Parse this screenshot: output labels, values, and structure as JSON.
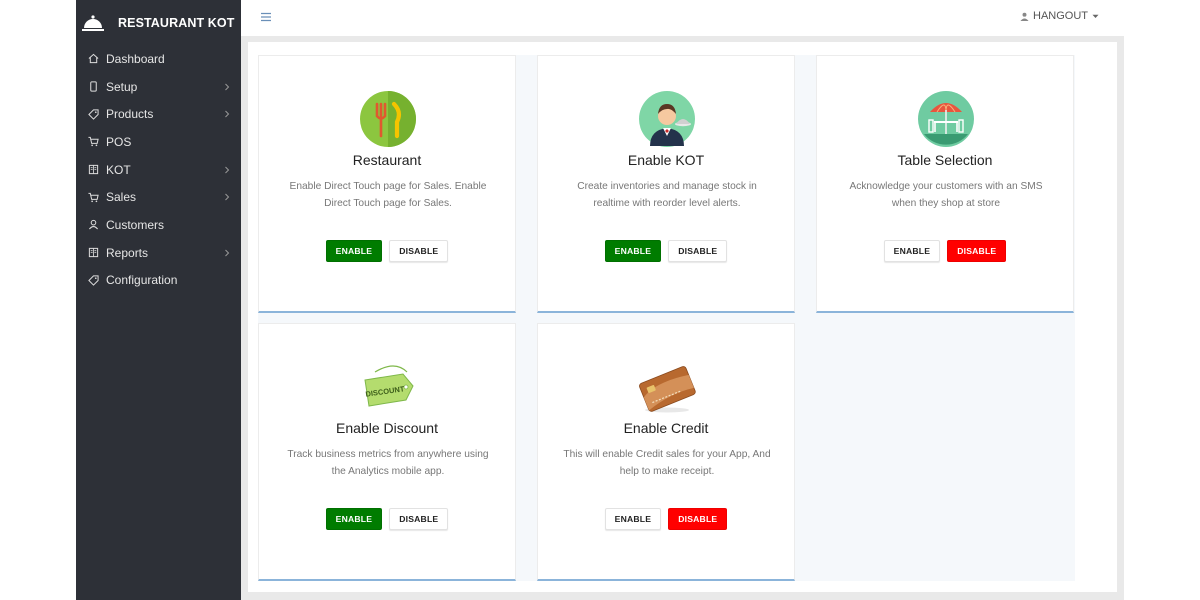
{
  "brand": {
    "title": "RESTAURANT KOT"
  },
  "sidebar": {
    "items": [
      {
        "label": "Dashboard",
        "icon": "home-icon",
        "submenu": false
      },
      {
        "label": "Setup",
        "icon": "phone-icon",
        "submenu": true
      },
      {
        "label": "Products",
        "icon": "tag-icon",
        "submenu": true
      },
      {
        "label": "POS",
        "icon": "cart-icon",
        "submenu": false
      },
      {
        "label": "KOT",
        "icon": "book-icon",
        "submenu": true
      },
      {
        "label": "Sales",
        "icon": "cart-icon",
        "submenu": true
      },
      {
        "label": "Customers",
        "icon": "user-icon",
        "submenu": false
      },
      {
        "label": "Reports",
        "icon": "book-icon",
        "submenu": true
      },
      {
        "label": "Configuration",
        "icon": "tag-icon",
        "submenu": false
      }
    ]
  },
  "header": {
    "user": "HANGOUT"
  },
  "cards": [
    {
      "title": "Restaurant",
      "desc": "Enable Direct Touch page for Sales. Enable Direct Touch page for Sales.",
      "enable": "ENABLE",
      "disable": "DISABLE",
      "state": "enabled",
      "illustration": "cutlery-icon"
    },
    {
      "title": "Enable KOT",
      "desc": "Create inventories and manage stock in realtime with reorder level alerts.",
      "enable": "ENABLE",
      "disable": "DISABLE",
      "state": "enabled",
      "illustration": "waiter-icon"
    },
    {
      "title": "Table Selection",
      "desc": "Acknowledge your customers with an SMS when they shop at store",
      "enable": "ENABLE",
      "disable": "DISABLE",
      "state": "disabled",
      "illustration": "table-umbrella-icon"
    },
    {
      "title": "Enable Discount",
      "desc": "Track business metrics from anywhere using the Analytics mobile app.",
      "enable": "ENABLE",
      "disable": "DISABLE",
      "state": "enabled",
      "illustration": "discount-tag-icon",
      "tag_text": "DISCOUNT"
    },
    {
      "title": "Enable Credit",
      "desc": "This will enable Credit sales for your App, And help to make receipt.",
      "enable": "ENABLE",
      "disable": "DISABLE",
      "state": "disabled",
      "illustration": "credit-card-icon"
    }
  ],
  "colors": {
    "sidebar_bg": "#2d3037",
    "enable_active": "#007c00",
    "disable_active": "#ff0000",
    "card_border_bottom": "#8bb4da"
  }
}
